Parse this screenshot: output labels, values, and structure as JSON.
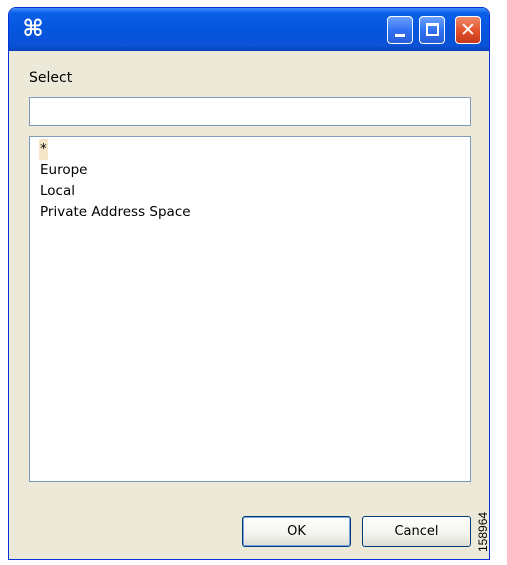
{
  "titlebar": {
    "app_icon": "⌘",
    "icon_name": "command-key-icon",
    "buttons": [
      "minimize-icon",
      "maximize-icon",
      "close-icon"
    ]
  },
  "dialog": {
    "label": "Select",
    "filter_value": "",
    "items": [
      "*",
      "Europe",
      "Local",
      "Private Address Space"
    ],
    "selected_index": 0,
    "ok_label": "OK",
    "cancel_label": "Cancel"
  },
  "figure_id": "158964",
  "colors": {
    "titlebar": "#0555de",
    "window_bg": "#ece9d8",
    "selection": "#f5e6c8",
    "close_button": "#e0502a"
  }
}
